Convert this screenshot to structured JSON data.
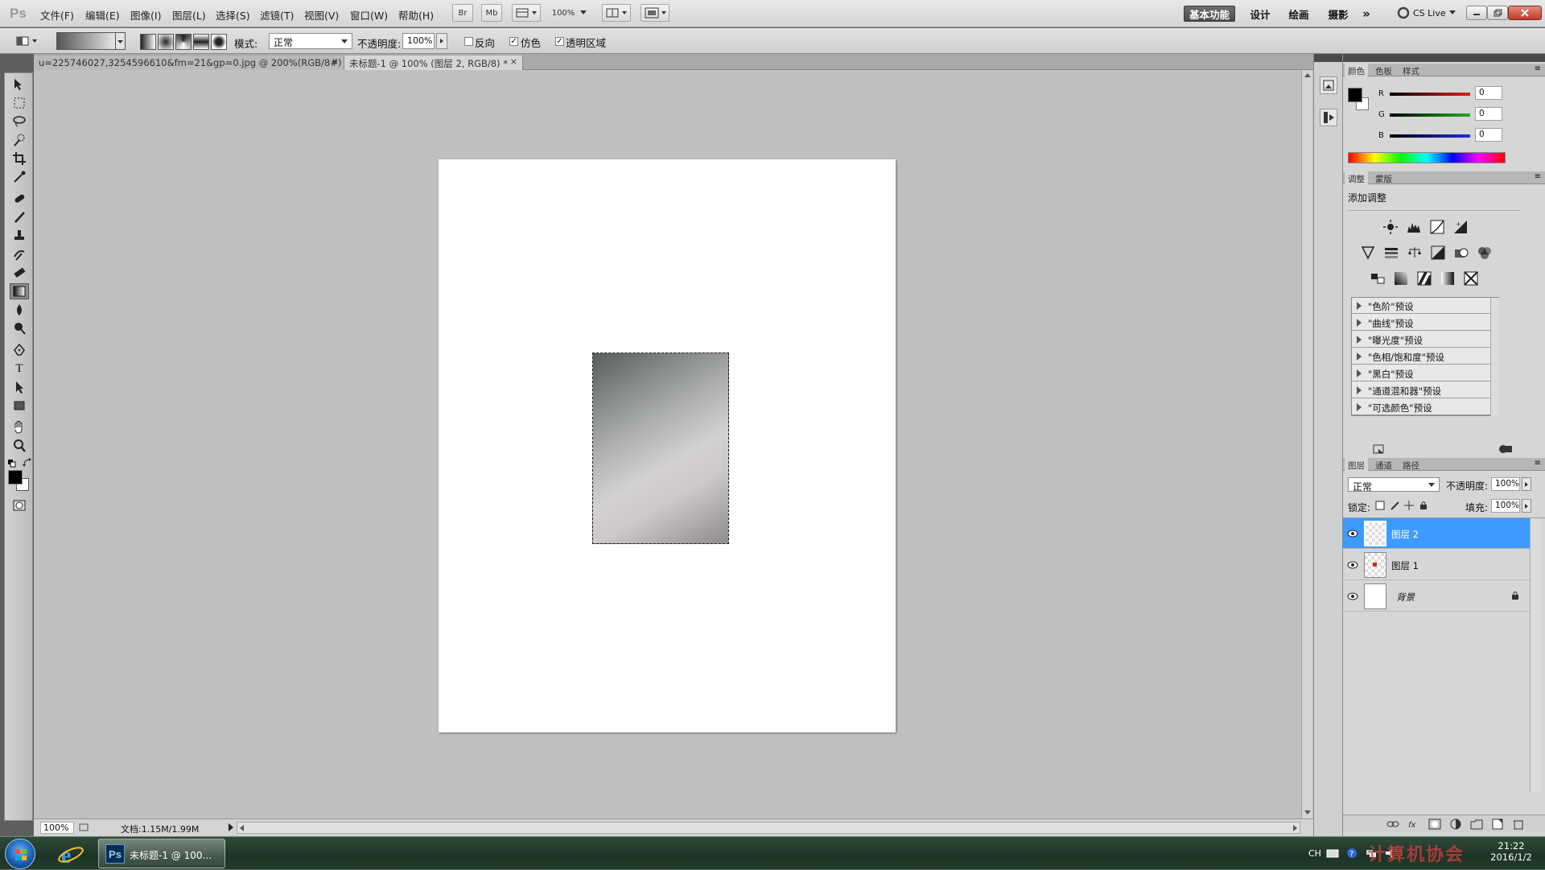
{
  "app": {
    "logo": "Ps"
  },
  "menu": [
    "文件(F)",
    "编辑(E)",
    "图像(I)",
    "图层(L)",
    "选择(S)",
    "滤镜(T)",
    "视图(V)",
    "窗口(W)",
    "帮助(H)"
  ],
  "toolbar_buttons": {
    "bridge": "Br",
    "minibridge": "Mb",
    "zoom": "100%"
  },
  "workspaces": [
    "基本功能",
    "设计",
    "绘画",
    "摄影"
  ],
  "cslive": "CS Live",
  "options": {
    "mode_label": "模式:",
    "mode_value": "正常",
    "opacity_label": "不透明度:",
    "opacity_value": "100%",
    "reverse_label": "反向",
    "dither_label": "仿色",
    "transparency_label": "透明区域"
  },
  "documents": {
    "tabs": [
      "u=225746027,3254596610&fm=21&gp=0.jpg @ 200%(RGB/8#)",
      "未标题-1 @ 100% (图层 2, RGB/8) *"
    ],
    "zoom": "100%",
    "doc_size": "文档:1.15M/1.99M"
  },
  "color_panel": {
    "tabs": [
      "颜色",
      "色板",
      "样式"
    ],
    "channels": [
      {
        "label": "R",
        "value": "0",
        "color": "#e02020"
      },
      {
        "label": "G",
        "value": "0",
        "color": "#20b020"
      },
      {
        "label": "B",
        "value": "0",
        "color": "#2030e0"
      }
    ]
  },
  "adjust_panel": {
    "tabs": [
      "调整",
      "蒙版"
    ],
    "title": "添加调整",
    "presets": [
      "\"色阶\"预设",
      "\"曲线\"预设",
      "\"曝光度\"预设",
      "\"色相/饱和度\"预设",
      "\"黑白\"预设",
      "\"通道混和器\"预设",
      "\"可选颜色\"预设"
    ]
  },
  "layers_panel": {
    "tabs": [
      "图层",
      "通道",
      "路径"
    ],
    "blend_mode": "正常",
    "opacity_label": "不透明度:",
    "opacity_value": "100%",
    "lock_label": "锁定:",
    "fill_label": "填充:",
    "fill_value": "100%",
    "layers": [
      {
        "name": "图层 2",
        "selected": true
      },
      {
        "name": "图层 1",
        "selected": false
      },
      {
        "name": "背景",
        "selected": false,
        "locked": true
      }
    ]
  },
  "taskbar": {
    "ps_task": "未标题-1 @ 100...",
    "lang": "CH",
    "time": "21:22",
    "date": "2016/1/2",
    "watermark": "计算机协会"
  }
}
